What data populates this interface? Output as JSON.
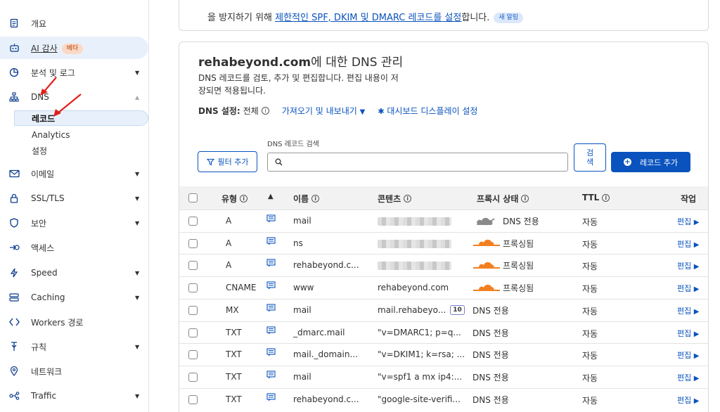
{
  "sidebar": {
    "items": [
      {
        "label": "개요",
        "icon": "document-icon"
      },
      {
        "label": "AI 감사",
        "icon": "robot-icon",
        "badge": "베타"
      },
      {
        "label": "분석 및 로그",
        "icon": "chart-icon"
      },
      {
        "label": "DNS",
        "icon": "network-icon"
      },
      {
        "label": "이메일",
        "icon": "email-icon"
      },
      {
        "label": "SSL/TLS",
        "icon": "lock-icon"
      },
      {
        "label": "보안",
        "icon": "shield-icon"
      },
      {
        "label": "액세스",
        "icon": "access-icon"
      },
      {
        "label": "Speed",
        "icon": "lightning-icon"
      },
      {
        "label": "Caching",
        "icon": "server-icon"
      },
      {
        "label": "Workers 경로",
        "icon": "workers-icon"
      },
      {
        "label": "규칙",
        "icon": "rules-icon"
      },
      {
        "label": "네트워크",
        "icon": "location-icon"
      },
      {
        "label": "Traffic",
        "icon": "traffic-icon"
      }
    ],
    "dns_subitems": [
      {
        "label": "레코드"
      },
      {
        "label": "Analytics"
      },
      {
        "label": "설정"
      }
    ]
  },
  "notice": {
    "prefix": "을 방지하기 위해 ",
    "link": "제한적인 SPF, DKIM 및 DMARC 레코드를 설정",
    "suffix": "합니다.",
    "badge": "새 알림"
  },
  "dns": {
    "domain": "rehabeyond.com",
    "title_suffix": "에 대한 DNS 관리",
    "description": "DNS 레코드를 검토, 추가 및 편집합니다. 편집 내용이 저장되면 적용됩니다.",
    "settings_key": "DNS 설정:",
    "settings_value": "전체",
    "import_export": "가져오기 및 내보내기",
    "dashboard_settings": "대시보드 디스플레이 설정",
    "search_label": "DNS 레코드 검색",
    "filter_button": "필터 추가",
    "search_button": "검색",
    "add_button": "레코드 추가",
    "columns": [
      "유형",
      "이름",
      "콘텐츠",
      "프록시 상태",
      "TTL",
      "작업"
    ],
    "records": [
      {
        "type": "A",
        "name": "mail",
        "content": "",
        "content_hidden": true,
        "proxy": "DNS 전용",
        "proxy_icon": "grey-cloud",
        "ttl": "자동",
        "action": "편집"
      },
      {
        "type": "A",
        "name": "ns",
        "content": "",
        "content_hidden": true,
        "proxy": "프록싱됨",
        "proxy_icon": "orange-cloud",
        "ttl": "자동",
        "action": "편집"
      },
      {
        "type": "A",
        "name": "rehabeyond.c...",
        "content": "",
        "content_hidden": true,
        "proxy": "프록싱됨",
        "proxy_icon": "orange-cloud",
        "ttl": "자동",
        "action": "편집"
      },
      {
        "type": "CNAME",
        "name": "www",
        "content": "rehabeyond.com",
        "proxy": "프록싱됨",
        "proxy_icon": "orange-cloud",
        "ttl": "자동",
        "action": "편집"
      },
      {
        "type": "MX",
        "name": "mail",
        "content": "mail.rehabeyo...",
        "priority": "10",
        "proxy": "DNS 전용",
        "ttl": "자동",
        "action": "편집"
      },
      {
        "type": "TXT",
        "name": "_dmarc.mail",
        "content": "\"v=DMARC1; p=q...",
        "proxy": "DNS 전용",
        "ttl": "자동",
        "action": "편집"
      },
      {
        "type": "TXT",
        "name": "mail._domain...",
        "content": "\"v=DKIM1; k=rsa; ...",
        "proxy": "DNS 전용",
        "ttl": "자동",
        "action": "편집"
      },
      {
        "type": "TXT",
        "name": "mail",
        "content": "\"v=spf1 a mx ip4:...",
        "proxy": "DNS 전용",
        "ttl": "자동",
        "action": "편집"
      },
      {
        "type": "TXT",
        "name": "rehabeyond.c...",
        "content": "\"google-site-verifi...",
        "proxy": "DNS 전용",
        "ttl": "자동",
        "action": "편집"
      }
    ]
  },
  "colors": {
    "accent": "#0a53be",
    "annotation_arrow": "#e0201b",
    "cloud_orange": "#f38020",
    "cloud_grey": "#8a8a8a"
  }
}
